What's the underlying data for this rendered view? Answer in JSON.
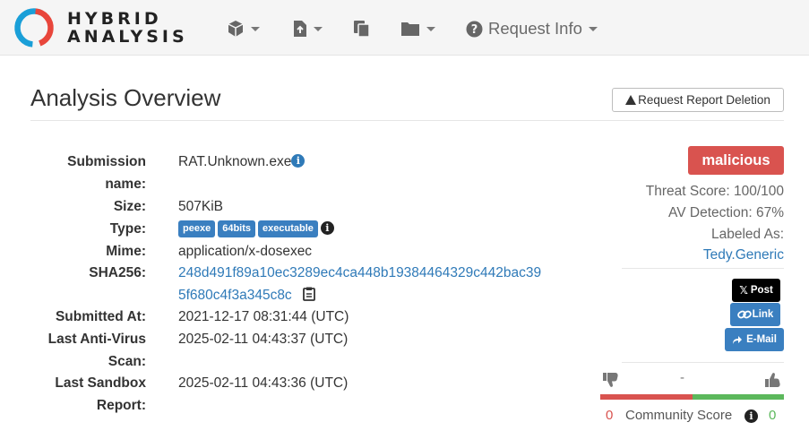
{
  "brand": {
    "line1": "HYBRID",
    "line2": "ANALYSIS"
  },
  "nav": {
    "request_info": "Request Info"
  },
  "page": {
    "title": "Analysis Overview",
    "request_deletion": "Request Report Deletion"
  },
  "details": {
    "submission_name_label1": "Submission",
    "submission_name_label2": "name:",
    "submission_name": "RAT.Unknown.exe",
    "size_label": "Size:",
    "size": "507KiB",
    "type_label": "Type:",
    "type_tags": [
      "peexe",
      "64bits",
      "executable"
    ],
    "mime_label": "Mime:",
    "mime": "application/x-dosexec",
    "sha256_label": "SHA256:",
    "sha256_line1": "248d491f89a10ec3289ec4ca448b19384464329c442bac39",
    "sha256_line2": "5f680c4f3a345c8c",
    "submitted_label": "Submitted At:",
    "submitted_at": "2021-12-17 08:31:44 (UTC)",
    "last_av_label1": "Last Anti-Virus",
    "last_av_label2": "Scan:",
    "last_av": "2025-02-11 04:43:37 (UTC)",
    "last_sandbox_label1": "Last Sandbox",
    "last_sandbox_label2": "Report:",
    "last_sandbox": "2025-02-11 04:43:36 (UTC)"
  },
  "summary": {
    "verdict": "malicious",
    "threat_score": "Threat Score: 100/100",
    "av_detection": "AV Detection: 67%",
    "labeled_as": "Labeled As:",
    "label_value": "Tedy.Generic"
  },
  "share": {
    "post": "Post",
    "link": "Link",
    "email": "E-Mail"
  },
  "community": {
    "dash": "-",
    "down_count": "0",
    "label": "Community Score",
    "up_count": "0",
    "up_fraction": 0.5
  },
  "colors": {
    "verdict": "#d9534f",
    "link": "#2f7ab8",
    "tag": "#3a7fc0",
    "bar_down": "#d9534f",
    "bar_up": "#5cb85c"
  }
}
